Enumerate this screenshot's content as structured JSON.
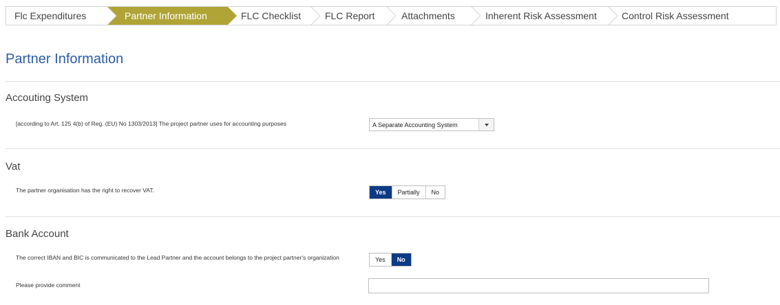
{
  "wizard": {
    "steps": [
      {
        "label": "Flc Expenditures",
        "active": false
      },
      {
        "label": "Partner Information",
        "active": true
      },
      {
        "label": "FLC Checklist",
        "active": false
      },
      {
        "label": "FLC Report",
        "active": false
      },
      {
        "label": "Attachments",
        "active": false
      },
      {
        "label": "Inherent Risk Assessment",
        "active": false
      },
      {
        "label": "Control Risk Assessment",
        "active": false
      }
    ],
    "active_color": "#b0a437"
  },
  "page": {
    "title": "Partner Information"
  },
  "accounting": {
    "section_title": "Accouting System",
    "question": "[according to Art. 125 4(b) of Reg. (EU) No 1303/2013] The project partner uses for accounting purposes",
    "selected_value": "A Separate Accounting System"
  },
  "vat": {
    "section_title": "Vat",
    "question": "The partner organisation has the right to recover VAT.",
    "options": [
      "Yes",
      "Partially",
      "No"
    ],
    "selected": "Yes"
  },
  "bank": {
    "section_title": "Bank Account",
    "question": "The correct IBAN and BIC is communicated to the Lead Partner and the account belongs to the project partner's organization",
    "options": [
      "Yes",
      "No"
    ],
    "selected": "No",
    "comment_label": "Please provide comment",
    "comment_value": ""
  },
  "colors": {
    "selected_toggle": "#0c3a85",
    "title": "#2a5caa"
  }
}
